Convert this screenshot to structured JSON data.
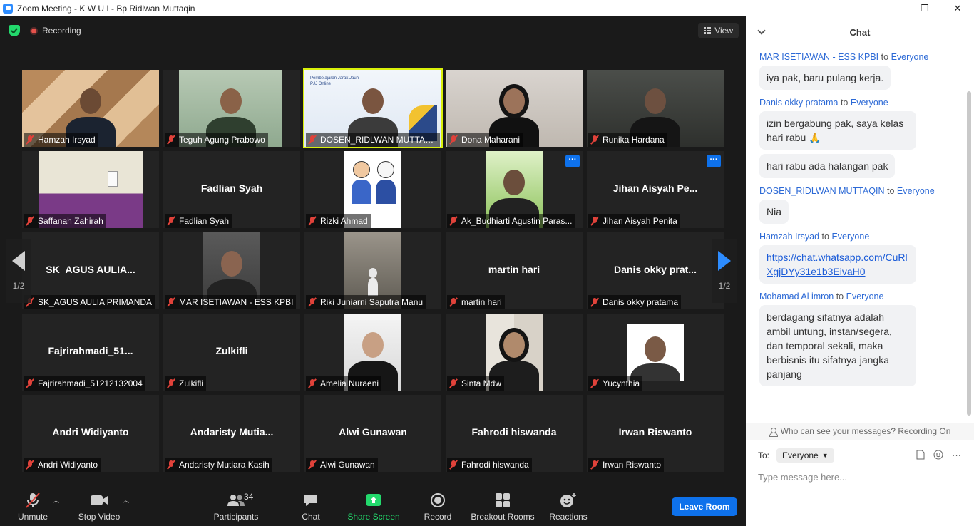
{
  "window": {
    "title": "Zoom Meeting - K W U I - Bp Ridlwan Muttaqin",
    "minimize": "—",
    "restore": "❐",
    "close": "✕"
  },
  "topbar": {
    "recording": "Recording",
    "view": "View"
  },
  "gallery": {
    "page_left": "1/2",
    "page_right": "1/2",
    "tiles": [
      {
        "name": "Hamzah Irsyad",
        "center": ""
      },
      {
        "name": "Teguh Agung Prabowo",
        "center": ""
      },
      {
        "name": "DOSEN_RIDLWAN MUTTAQIN",
        "center": ""
      },
      {
        "name": "Dona Maharani",
        "center": ""
      },
      {
        "name": "Runika Hardana",
        "center": ""
      },
      {
        "name": "Saffanah Zahirah",
        "center": ""
      },
      {
        "name": "Fadlian Syah",
        "center": "Fadlian Syah"
      },
      {
        "name": "Rizki Ahmad",
        "center": ""
      },
      {
        "name": "Ak_Budhiarti Agustin Paras...",
        "center": ""
      },
      {
        "name": "Jihan Aisyah Penita",
        "center": "Jihan Aisyah Pe..."
      },
      {
        "name": "SK_AGUS AULIA PRIMANDA",
        "center": "SK_AGUS AULIA..."
      },
      {
        "name": "MAR ISETIAWAN - ESS KPBI",
        "center": ""
      },
      {
        "name": "Riki Juniarni Saputra Manu",
        "center": ""
      },
      {
        "name": "martin hari",
        "center": "martin hari"
      },
      {
        "name": "Danis okky pratama",
        "center": "Danis okky prat..."
      },
      {
        "name": "Fajrirahmadi_51212132004",
        "center": "Fajrirahmadi_51..."
      },
      {
        "name": "Zulkifli",
        "center": "Zulkifli"
      },
      {
        "name": "Amelia Nuraeni",
        "center": ""
      },
      {
        "name": "Sinta Mdw",
        "center": ""
      },
      {
        "name": "Yucynthia",
        "center": ""
      },
      {
        "name": "Andri Widiyanto",
        "center": "Andri Widiyanto"
      },
      {
        "name": "Andaristy Mutiara Kasih",
        "center": "Andaristy Mutia..."
      },
      {
        "name": "Alwi Gunawan",
        "center": "Alwi Gunawan"
      },
      {
        "name": "Fahrodi hiswanda",
        "center": "Fahrodi hiswanda"
      },
      {
        "name": "Irwan Riswanto",
        "center": "Irwan Riswanto"
      }
    ],
    "slide_title": "Pembelajaran Jarak Jauh",
    "slide_subtitle": "PJJ Online",
    "more_label": "···"
  },
  "toolbar": {
    "unmute": "Unmute",
    "stop_video": "Stop Video",
    "participants": "Participants",
    "participants_count": "34",
    "chat": "Chat",
    "share_screen": "Share Screen",
    "record": "Record",
    "breakout_rooms": "Breakout Rooms",
    "reactions": "Reactions",
    "leave_room": "Leave Room"
  },
  "chat": {
    "header": "Chat",
    "to_word": "to",
    "messages": [
      {
        "sender": "MAR ISETIAWAN - ESS KPBI",
        "to": "Everyone",
        "texts": [
          "iya pak, baru pulang kerja."
        ]
      },
      {
        "sender": "Danis okky pratama",
        "to": "Everyone",
        "texts": [
          "izin bergabung pak, saya kelas hari rabu 🙏",
          "hari rabu ada halangan pak"
        ]
      },
      {
        "sender": "DOSEN_RIDLWAN MUTTAQIN",
        "to": "Everyone",
        "texts": [
          "Nia"
        ]
      },
      {
        "sender": "Hamzah Irsyad",
        "to": "Everyone",
        "texts": [
          "https://chat.whatsapp.com/CuRlXgjDYy31e1b3EivaH0"
        ],
        "link": true
      },
      {
        "sender": "Mohamad Al imron",
        "to": "Everyone",
        "texts": [
          "berdagang sifatnya adalah ambil untung, instan/segera, dan temporal sekali, maka berbisnis itu sifatnya jangka panjang"
        ]
      }
    ],
    "who_can_see": "Who can see your messages? Recording On",
    "to_label": "To:",
    "to_value": "Everyone",
    "input_placeholder": "Type message here..."
  },
  "colors": {
    "accent": "#0e71eb",
    "speaking": "#d9f00a",
    "share": "#23d96c",
    "muted": "#e0423a"
  }
}
